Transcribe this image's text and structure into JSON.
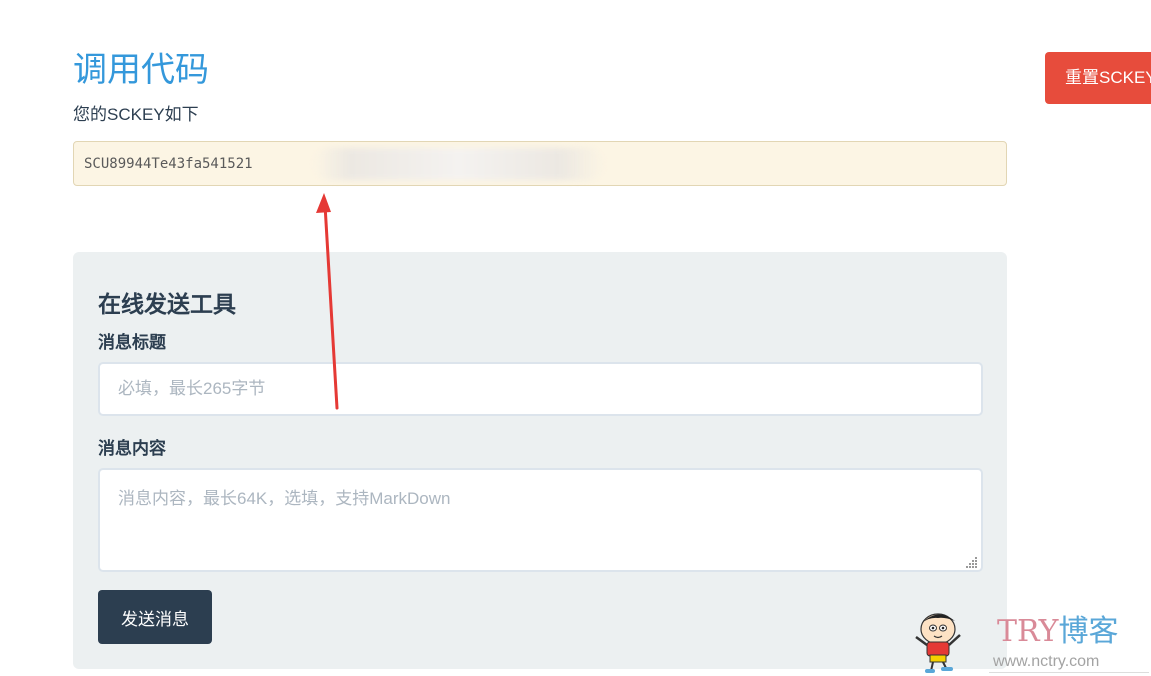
{
  "page": {
    "title": "调用代码",
    "sckey_label": "您的SCKEY如下",
    "sckey_value": "SCU89944Te43fa541521",
    "reset_button_label": "重置SCKEY"
  },
  "send_tool": {
    "title": "在线发送工具",
    "message_title_label": "消息标题",
    "message_title_placeholder": "必填，最长265字节",
    "message_content_label": "消息内容",
    "message_content_placeholder": "消息内容，最长64K，选填，支持MarkDown",
    "send_button_label": "发送消息"
  },
  "watermark": {
    "brand_prefix": "TRY",
    "brand_suffix": "博客",
    "url": "www.nctry.com"
  },
  "colors": {
    "accent": "#3498db",
    "danger": "#e74c3c",
    "dark": "#2c3e50",
    "annotation": "#e53935"
  }
}
